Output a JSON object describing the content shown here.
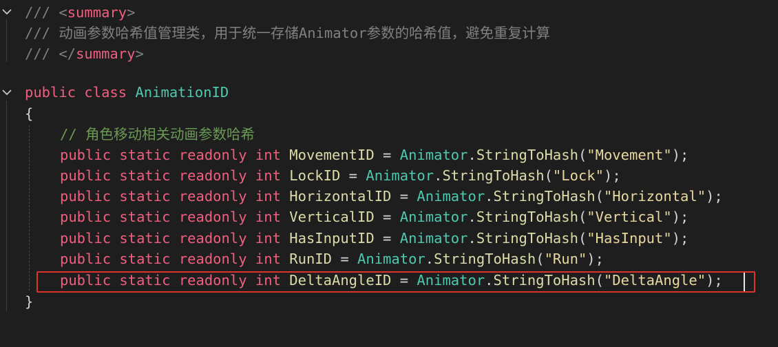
{
  "editor": {
    "summary_open": {
      "prefix": "/// ",
      "open": "<",
      "name": "summary",
      "close": ">"
    },
    "summary_text": "/// 动画参数哈希值管理类，用于统一存储Animator参数的哈希值，避免重复计算",
    "summary_close": {
      "prefix": "/// ",
      "open": "</",
      "name": "summary",
      "close": ">"
    },
    "class_decl": {
      "kw1": "public",
      "kw2": "class",
      "name": "AnimationID"
    },
    "brace_open": "{",
    "comment": "// 角色移动相关动画参数哈希",
    "decl": {
      "kw1": "public",
      "kw2": "static",
      "kw3": "readonly",
      "kw4": "int"
    },
    "fields": [
      {
        "name": "MovementID",
        "type": "Animator",
        "method": "StringToHash",
        "arg": "\"Movement\""
      },
      {
        "name": "LockID",
        "type": "Animator",
        "method": "StringToHash",
        "arg": "\"Lock\""
      },
      {
        "name": "HorizontalID",
        "type": "Animator",
        "method": "StringToHash",
        "arg": "\"Horizontal\""
      },
      {
        "name": "VerticalID",
        "type": "Animator",
        "method": "StringToHash",
        "arg": "\"Vertical\""
      },
      {
        "name": "HasInputID",
        "type": "Animator",
        "method": "StringToHash",
        "arg": "\"HasInput\""
      },
      {
        "name": "RunID",
        "type": "Animator",
        "method": "StringToHash",
        "arg": "\"Run\""
      },
      {
        "name": "DeltaAngleID",
        "type": "Animator",
        "method": "StringToHash",
        "arg": "\"DeltaAngle\""
      }
    ],
    "brace_close": "}",
    "icons": {
      "fold": "chevron-down-icon"
    },
    "colors": {
      "background": "#1e1e1e",
      "keyword": "#f15f80",
      "type": "#4ec9b0",
      "method": "#dcdcaa",
      "string": "#e8d8a0",
      "highlight_border": "#e0322d"
    }
  }
}
